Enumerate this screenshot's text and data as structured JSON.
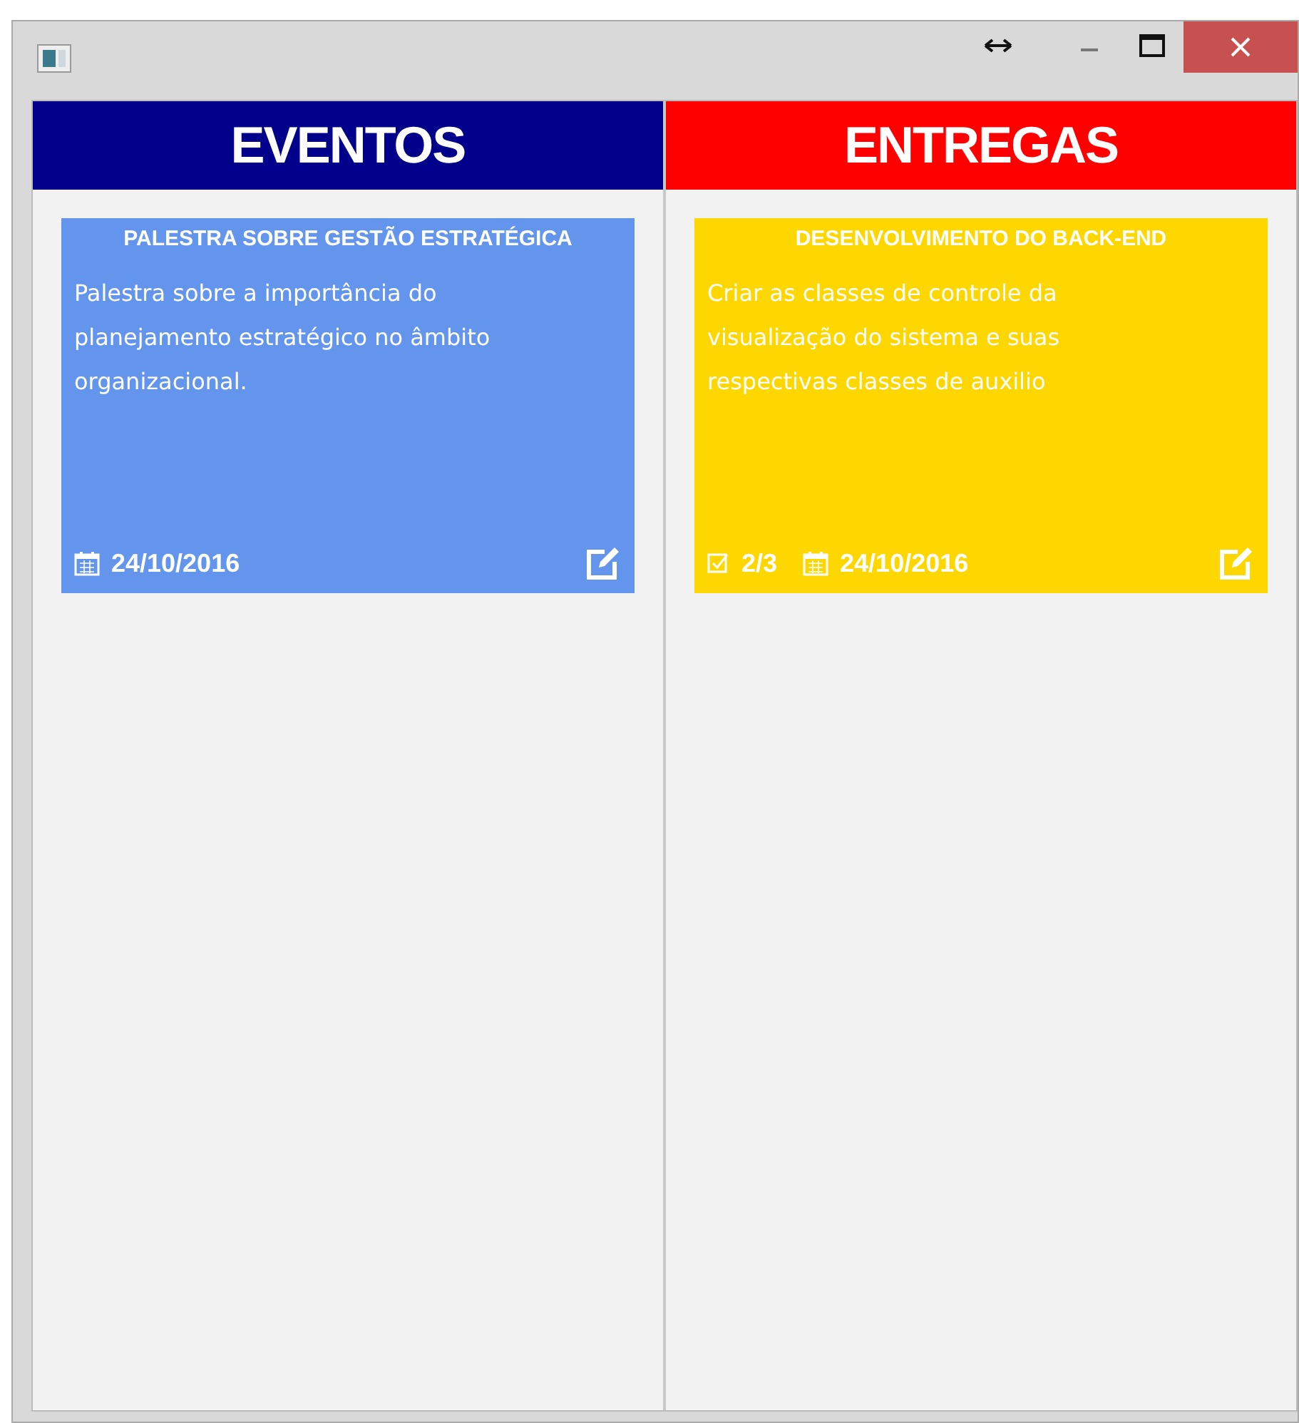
{
  "window": {
    "controls": [
      {
        "kind": "resize"
      },
      {
        "kind": "minimize"
      },
      {
        "kind": "maximize"
      },
      {
        "kind": "close"
      }
    ]
  },
  "columns": [
    {
      "title": "EVENTOS",
      "color": "#00008b",
      "cards": [
        {
          "title": "PALESTRA SOBRE GESTÃO ESTRATÉGICA",
          "description": "Palestra sobre a importância do planejamento estratégico no âmbito organizacional.",
          "color": "#6495ed",
          "date": "24/10/2016"
        }
      ]
    },
    {
      "title": "ENTREGAS",
      "color": "#ff0000",
      "cards": [
        {
          "title": "DESENVOLVIMENTO DO BACK-END",
          "description": "Criar as classes de controle da visualização do sistema e suas respectivas classes de auxilio",
          "color": "#ffd700",
          "checklist": "2/3",
          "date": "24/10/2016"
        }
      ]
    }
  ]
}
